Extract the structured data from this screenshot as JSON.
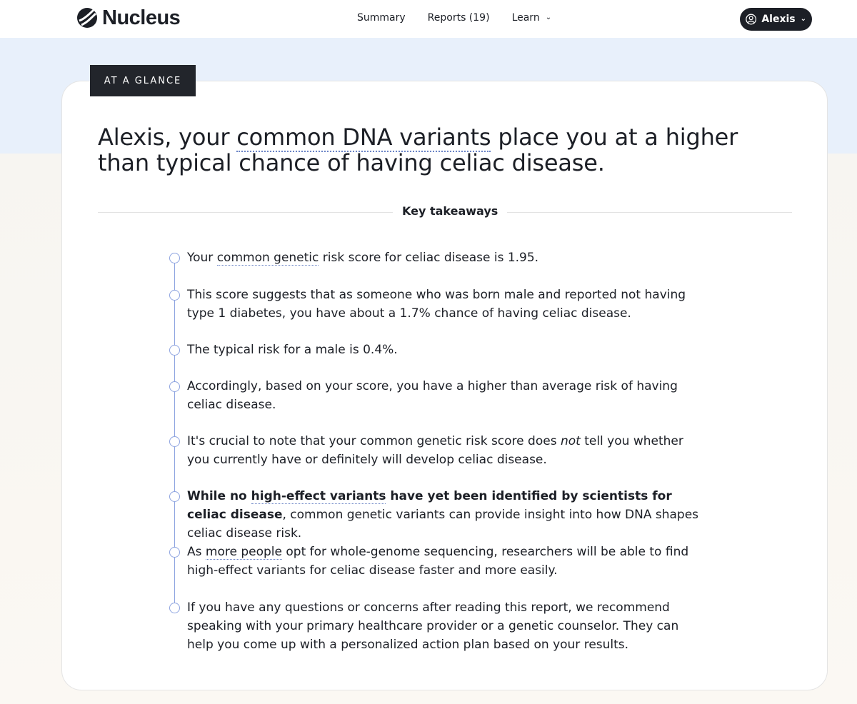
{
  "brand": {
    "name": "Nucleus"
  },
  "nav": {
    "summary": "Summary",
    "reports": "Reports (19)",
    "learn": "Learn"
  },
  "user": {
    "name": "Alexis"
  },
  "card": {
    "tag": "AT A GLANCE",
    "headline": {
      "part1": "Alexis, your ",
      "link": "common DNA variants",
      "part2": " place you at a higher than typical chance of having celiac disease."
    },
    "takeaways_title": "Key takeaways"
  },
  "takeaways": {
    "t1": {
      "a": "Your ",
      "link": "common genetic",
      "b": " risk score for celiac disease is 1.95."
    },
    "t2": "This score suggests that as someone who was born male and reported not having type 1 diabetes, you have about a 1.7% chance of having celiac disease.",
    "t3": "The typical risk for a male is 0.4%.",
    "t4": "Accordingly, based on your score, you have a higher than average risk of having celiac disease.",
    "t5": {
      "a": "It's crucial to note that your common genetic risk score does ",
      "em": "not",
      "b": " tell you whether you currently have or definitely will develop celiac disease."
    },
    "t6": {
      "bold_a": "While no ",
      "link": "high-effect variants",
      "bold_b": " have yet been identified by scientists for celiac disease",
      "rest": ", common genetic variants can provide insight into how DNA shapes celiac disease risk."
    },
    "t7": {
      "a": "As ",
      "link": "more people",
      "b": " opt for whole-genome sequencing, researchers will be able to find high-effect variants for celiac disease faster and more easily."
    },
    "t8": "If you have any questions or concerns after reading this report, we recommend speaking with your primary healthcare provider or a genetic counselor. They can help you come up with a personalized action plan based on your results."
  }
}
